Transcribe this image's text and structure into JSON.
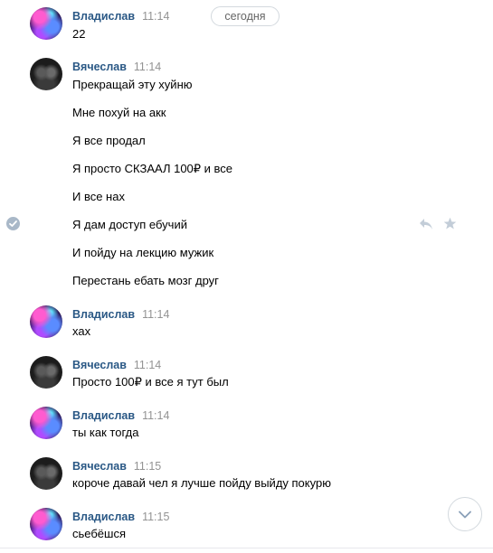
{
  "date_separator": "сегодня",
  "messages": [
    {
      "author": "Владислав",
      "time": "11:14",
      "lines": [
        "22"
      ]
    },
    {
      "author": "Вячеслав",
      "time": "11:14",
      "lines": [
        "Прекращай эту хуйню",
        "Мне похуй на акк",
        "Я все продал",
        "Я просто СКЗААЛ 100₽ и все",
        "И все нах",
        "Я дам доступ ебучий",
        "И пойду на лекцию мужик",
        "Перестань ебать мозг друг"
      ]
    },
    {
      "author": "Владислав",
      "time": "11:14",
      "lines": [
        "хах"
      ]
    },
    {
      "author": "Вячеслав",
      "time": "11:14",
      "lines": [
        "Просто 100₽ и все я тут был"
      ]
    },
    {
      "author": "Владислав",
      "time": "11:14",
      "lines": [
        "ты как тогда"
      ]
    },
    {
      "author": "Вячеслав",
      "time": "11:15",
      "lines": [
        "короче давай чел я лучше пойду выйду покурю"
      ]
    },
    {
      "author": "Владислав",
      "time": "11:15",
      "lines": [
        "сьебёшся"
      ]
    }
  ],
  "colors": {
    "author_link": "#2a5885",
    "time": "#939393",
    "border": "#d3d9de",
    "icon_gray": "#c3cdd8"
  },
  "icons": {
    "selected_check": "check-circle-icon",
    "reply": "reply-icon",
    "favorite": "star-icon",
    "scroll_down": "chevron-down-icon"
  }
}
